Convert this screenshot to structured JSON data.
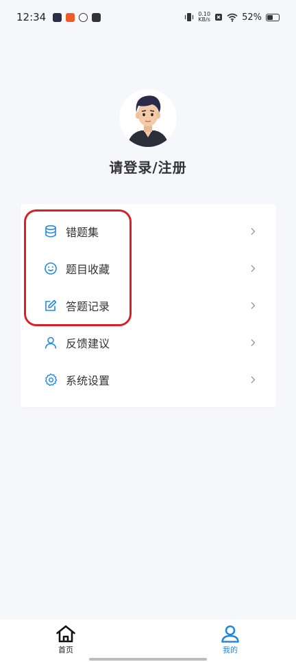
{
  "status_bar": {
    "time": "12:34",
    "net_speed_value": "0.10",
    "net_speed_unit": "KB/s",
    "battery": "52%"
  },
  "profile": {
    "login_text": "请登录/注册"
  },
  "menu": {
    "items": [
      {
        "label": "错题集",
        "icon": "database-icon"
      },
      {
        "label": "题目收藏",
        "icon": "smile-icon"
      },
      {
        "label": "答题记录",
        "icon": "edit-icon"
      },
      {
        "label": "反馈建议",
        "icon": "user-icon"
      },
      {
        "label": "系统设置",
        "icon": "gear-icon"
      }
    ]
  },
  "bottom_nav": {
    "home_label": "首页",
    "mine_label": "我的"
  },
  "colors": {
    "accent": "#1e88e5",
    "highlight": "#d91f26",
    "background": "#f6f7fb"
  }
}
